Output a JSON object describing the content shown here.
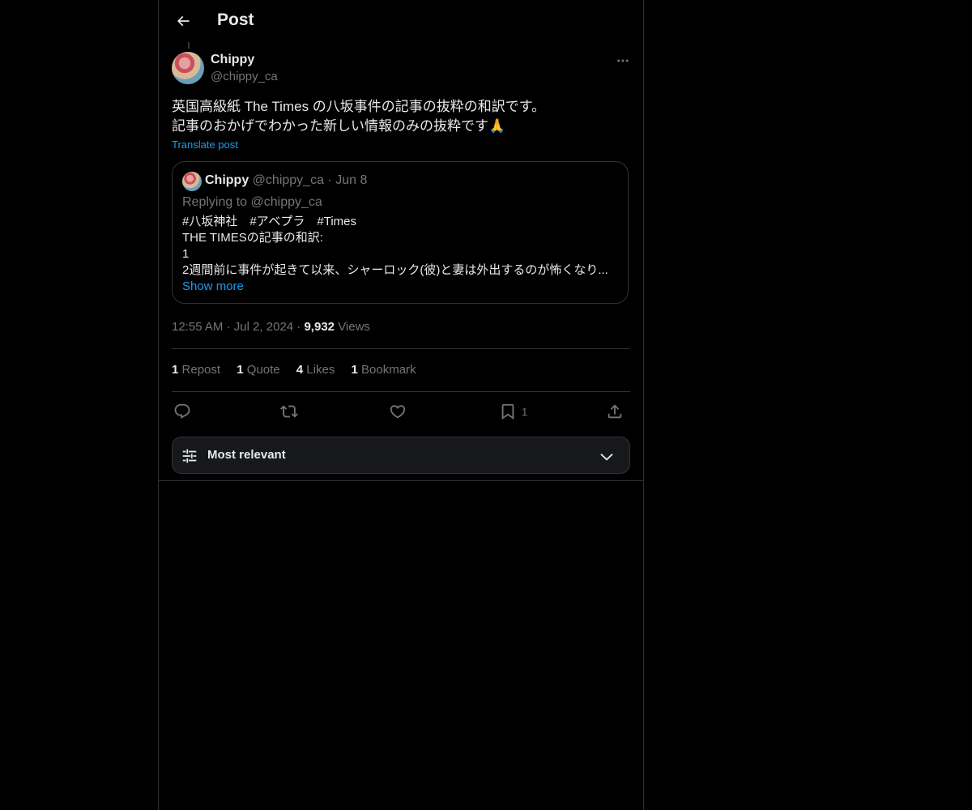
{
  "header": {
    "title": "Post"
  },
  "post": {
    "author_name": "Chippy",
    "author_handle": "@chippy_ca",
    "text_lines": [
      "英国高級紙 The Times の八坂事件の記事の抜粋の和訳です。",
      "記事のおかげでわかった新しい情報のみの抜粋です🙏"
    ],
    "translate_label": "Translate post"
  },
  "quote": {
    "author_name": "Chippy",
    "author_handle": "@chippy_ca",
    "separator": "·",
    "date": "Jun 8",
    "replying_to": "Replying to @chippy_ca",
    "body_lines": [
      "#八坂神社　#アベプラ　#Times",
      "THE TIMESの記事の和訳:",
      "1",
      "2週間前に事件が起きて以来、シャーロック(彼)と妻は外出するのが怖くなり..."
    ],
    "show_more": "Show more"
  },
  "meta": {
    "time": "12:55 AM",
    "separator": "·",
    "date": "Jul 2, 2024",
    "views_count": "9,932",
    "views_label": "Views"
  },
  "stats": {
    "reposts_count": "1",
    "reposts_label": "Repost",
    "quotes_count": "1",
    "quotes_label": "Quote",
    "likes_count": "4",
    "likes_label": "Likes",
    "bookmarks_count": "1",
    "bookmarks_label": "Bookmark"
  },
  "actions": {
    "reply_icon": "reply-icon",
    "repost_icon": "repost-icon",
    "like_icon": "heart-icon",
    "bookmark_icon": "bookmark-icon",
    "bookmark_count": "1",
    "share_icon": "share-icon"
  },
  "sort": {
    "label": "Most relevant"
  },
  "colors": {
    "background": "#000000",
    "text": "#e7e9ea",
    "muted": "#71767b",
    "accent": "#1d9bf0",
    "border": "#2f3336"
  }
}
